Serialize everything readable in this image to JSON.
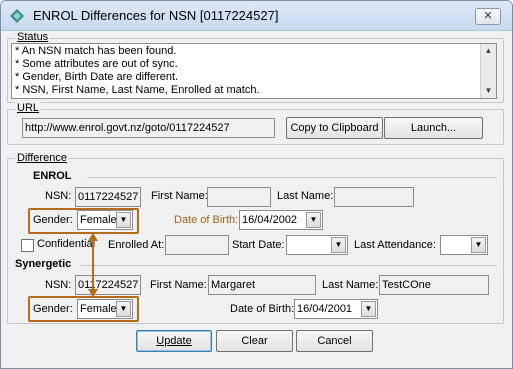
{
  "window": {
    "title": "ENROL Differences for NSN [0117224527]",
    "close_label": "✕"
  },
  "status": {
    "label": "Status",
    "lines": [
      "* An NSN match has been found.",
      "* Some attributes are out of sync.",
      "* Gender, Birth Date are different.",
      "* NSN, First Name, Last Name, Enrolled at match."
    ]
  },
  "url": {
    "label": "URL",
    "value": "http://www.enrol.govt.nz/goto/0117224527",
    "copy_label": "Copy to Clipboard",
    "launch_label": "Launch..."
  },
  "difference": {
    "label": "Difference",
    "enrol": {
      "heading": "ENROL",
      "nsn_label": "NSN:",
      "nsn_value": "0117224527",
      "first_name_label": "First Name:",
      "first_name_value": "",
      "last_name_label": "Last Name:",
      "last_name_value": "",
      "gender_label": "Gender:",
      "gender_value": "Female",
      "dob_label": "Date of Birth:",
      "dob_value": "16/04/2002",
      "confidential_label": "Confidential",
      "enrolled_at_label": "Enrolled At:",
      "enrolled_at_value": "",
      "start_date_label": "Start Date:",
      "start_date_value": "",
      "last_attendance_label": "Last Attendance:",
      "last_attendance_value": ""
    },
    "synergetic": {
      "heading": "Synergetic",
      "nsn_label": "NSN:",
      "nsn_value": "0117224527",
      "first_name_label": "First Name:",
      "first_name_value": "Margaret",
      "last_name_label": "Last Name:",
      "last_name_value": "TestCOne",
      "gender_label": "Gender:",
      "gender_value": "Female",
      "dob_label": "Date of Birth:",
      "dob_value": "16/04/2001"
    }
  },
  "buttons": {
    "update_label": "Update",
    "clear_label": "Clear",
    "cancel_label": "Cancel"
  },
  "colors": {
    "highlight": "#b26c1a",
    "diff_label": "#a0651e"
  },
  "icons": [
    "app-icon",
    "close-icon",
    "scroll-up-icon",
    "scroll-down-icon",
    "dropdown-arrow-icon",
    "double-arrow-icon"
  ]
}
